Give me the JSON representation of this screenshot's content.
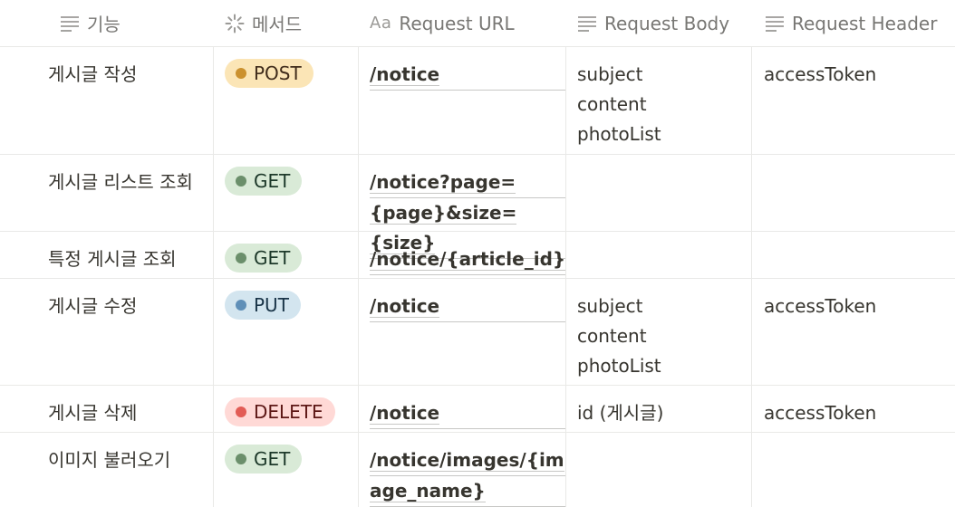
{
  "header": {
    "col1": "기능",
    "col2": "메서드",
    "col3_prefix": "Aa",
    "col3": "Request URL",
    "col4": "Request Body",
    "col5": "Request Header"
  },
  "method_styles": {
    "POST": {
      "bg": "#fbe5b6",
      "dot": "#cb912f",
      "text": "#402c1b"
    },
    "GET": {
      "bg": "#d9ead7",
      "dot": "#6b8f6b",
      "text": "#1c3829"
    },
    "PUT": {
      "bg": "#d3e5ef",
      "dot": "#5f8fb8",
      "text": "#183347"
    },
    "DELETE": {
      "bg": "#ffd9d6",
      "dot": "#e25c55",
      "text": "#5d1715"
    }
  },
  "rows": [
    {
      "feature": "게시글 작성",
      "method": "POST",
      "url": [
        "/notice"
      ],
      "body": [
        "subject",
        "content",
        "photoList"
      ],
      "header": "accessToken"
    },
    {
      "feature": "게시글 리스트 조회",
      "method": "GET",
      "url": [
        "/notice?page=",
        "{page}&size={size}"
      ],
      "body": [],
      "header": ""
    },
    {
      "feature": "특정 게시글 조회",
      "method": "GET",
      "url": [
        "/notice/{article_id}"
      ],
      "body": [],
      "header": ""
    },
    {
      "feature": "게시글 수정",
      "method": "PUT",
      "url": [
        "/notice"
      ],
      "body": [
        "subject",
        "content",
        "photoList"
      ],
      "header": "accessToken"
    },
    {
      "feature": "게시글 삭제",
      "method": "DELETE",
      "url": [
        "/notice"
      ],
      "body": [
        "id (게시글)"
      ],
      "header": "accessToken"
    },
    {
      "feature": "이미지 불러오기",
      "method": "GET",
      "url": [
        "/notice/images/{im",
        "age_name}"
      ],
      "body": [],
      "header": ""
    }
  ]
}
